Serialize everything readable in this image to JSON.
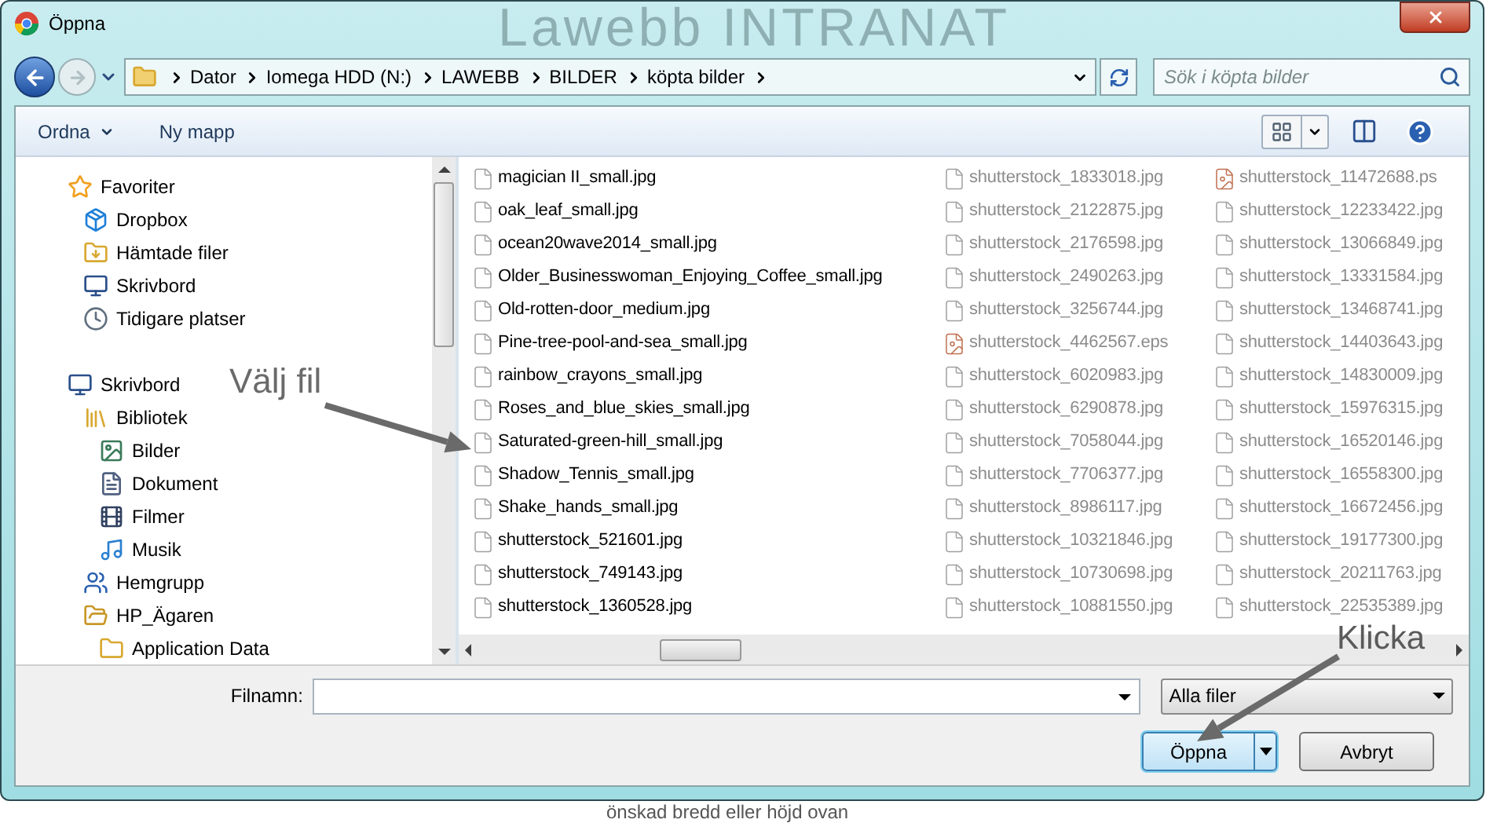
{
  "window": {
    "title": "Öppna"
  },
  "background": {
    "logo": "Lawebb INTRANAT",
    "caption": "önskad bredd eller höjd ovan"
  },
  "address_bar": {
    "crumbs": [
      "Dator",
      "Iomega HDD (N:)",
      "LAWEBB",
      "BILDER",
      "köpta bilder"
    ]
  },
  "search": {
    "placeholder": "Sök i köpta bilder"
  },
  "toolbar": [
    {
      "label": "Ordna",
      "kind": "menu"
    },
    {
      "label": "Ny mapp",
      "kind": "button"
    }
  ],
  "navigation": [
    {
      "label": "Favoriter",
      "kind": "favorites",
      "children": [
        {
          "label": "Dropbox",
          "kind": "dropbox"
        },
        {
          "label": "Hämtade filer",
          "kind": "downloads"
        },
        {
          "label": "Skrivbord",
          "kind": "desktop"
        },
        {
          "label": "Tidigare platser",
          "kind": "recent"
        }
      ]
    },
    {
      "label": "Skrivbord",
      "kind": "desktop",
      "children": [
        {
          "label": "Bibliotek",
          "kind": "library",
          "children": [
            {
              "label": "Bilder",
              "kind": "pictures"
            },
            {
              "label": "Dokument",
              "kind": "documents"
            },
            {
              "label": "Filmer",
              "kind": "videos"
            },
            {
              "label": "Musik",
              "kind": "music"
            }
          ]
        },
        {
          "label": "Hemgrupp",
          "kind": "homegroup"
        },
        {
          "label": "HP_Ägaren",
          "kind": "user",
          "children": [
            {
              "label": "Application Data",
              "kind": "folder"
            }
          ]
        }
      ]
    }
  ],
  "files": [
    {
      "name": "magician II_small.jpg",
      "kind": "document",
      "dimmed": false
    },
    {
      "name": "oak_leaf_small.jpg",
      "kind": "document",
      "dimmed": false
    },
    {
      "name": "ocean20wave2014_small.jpg",
      "kind": "document",
      "dimmed": false
    },
    {
      "name": "Older_Businesswoman_Enjoying_Coffee_small.jpg",
      "kind": "document",
      "dimmed": false
    },
    {
      "name": "Old-rotten-door_medium.jpg",
      "kind": "document",
      "dimmed": false
    },
    {
      "name": "Pine-tree-pool-and-sea_small.jpg",
      "kind": "document",
      "dimmed": false
    },
    {
      "name": "rainbow_crayons_small.jpg",
      "kind": "document",
      "dimmed": false
    },
    {
      "name": "Roses_and_blue_skies_small.jpg",
      "kind": "document",
      "dimmed": false
    },
    {
      "name": "Saturated-green-hill_small.jpg",
      "kind": "document",
      "dimmed": false
    },
    {
      "name": "Shadow_Tennis_small.jpg",
      "kind": "document",
      "dimmed": false
    },
    {
      "name": "Shake_hands_small.jpg",
      "kind": "document",
      "dimmed": false
    },
    {
      "name": "shutterstock_521601.jpg",
      "kind": "document",
      "dimmed": false
    },
    {
      "name": "shutterstock_749143.jpg",
      "kind": "document",
      "dimmed": false
    },
    {
      "name": "shutterstock_1360528.jpg",
      "kind": "document",
      "dimmed": false
    },
    {
      "name": "shutterstock_1833018.jpg",
      "kind": "document",
      "dimmed": true
    },
    {
      "name": "shutterstock_2122875.jpg",
      "kind": "document",
      "dimmed": true
    },
    {
      "name": "shutterstock_2176598.jpg",
      "kind": "document",
      "dimmed": true
    },
    {
      "name": "shutterstock_2490263.jpg",
      "kind": "document",
      "dimmed": true
    },
    {
      "name": "shutterstock_3256744.jpg",
      "kind": "document",
      "dimmed": true
    },
    {
      "name": "shutterstock_4462567.eps",
      "kind": "graphic",
      "dimmed": true
    },
    {
      "name": "shutterstock_6020983.jpg",
      "kind": "document",
      "dimmed": true
    },
    {
      "name": "shutterstock_6290878.jpg",
      "kind": "document",
      "dimmed": true
    },
    {
      "name": "shutterstock_7058044.jpg",
      "kind": "document",
      "dimmed": true
    },
    {
      "name": "shutterstock_7706377.jpg",
      "kind": "document",
      "dimmed": true
    },
    {
      "name": "shutterstock_8986117.jpg",
      "kind": "document",
      "dimmed": true
    },
    {
      "name": "shutterstock_10321846.jpg",
      "kind": "document",
      "dimmed": true
    },
    {
      "name": "shutterstock_10730698.jpg",
      "kind": "document",
      "dimmed": true
    },
    {
      "name": "shutterstock_10881550.jpg",
      "kind": "document",
      "dimmed": true
    },
    {
      "name": "shutterstock_11472688.ps",
      "kind": "graphic",
      "dimmed": true
    },
    {
      "name": "shutterstock_12233422.jpg",
      "kind": "document",
      "dimmed": true
    },
    {
      "name": "shutterstock_13066849.jpg",
      "kind": "document",
      "dimmed": true
    },
    {
      "name": "shutterstock_13331584.jpg",
      "kind": "document",
      "dimmed": true
    },
    {
      "name": "shutterstock_13468741.jpg",
      "kind": "document",
      "dimmed": true
    },
    {
      "name": "shutterstock_14403643.jpg",
      "kind": "document",
      "dimmed": true
    },
    {
      "name": "shutterstock_14830009.jpg",
      "kind": "document",
      "dimmed": true
    },
    {
      "name": "shutterstock_15976315.jpg",
      "kind": "document",
      "dimmed": true
    },
    {
      "name": "shutterstock_16520146.jpg",
      "kind": "document",
      "dimmed": true
    },
    {
      "name": "shutterstock_16558300.jpg",
      "kind": "document",
      "dimmed": true
    },
    {
      "name": "shutterstock_16672456.jpg",
      "kind": "document",
      "dimmed": true
    },
    {
      "name": "shutterstock_19177300.jpg",
      "kind": "document",
      "dimmed": true
    },
    {
      "name": "shutterstock_20211763.jpg",
      "kind": "document",
      "dimmed": true
    },
    {
      "name": "shutterstock_22535389.jpg",
      "kind": "document",
      "dimmed": true
    }
  ],
  "file_name": {
    "label": "Filnamn:"
  },
  "file_type": {
    "value": "Alla filer"
  },
  "buttons": [
    {
      "label": "Öppna",
      "kind": "split",
      "default": true
    },
    {
      "label": "Avbryt",
      "kind": "plain",
      "default": false
    }
  ],
  "annotations": [
    {
      "text": "Välj fil"
    },
    {
      "text": "Klicka"
    }
  ]
}
